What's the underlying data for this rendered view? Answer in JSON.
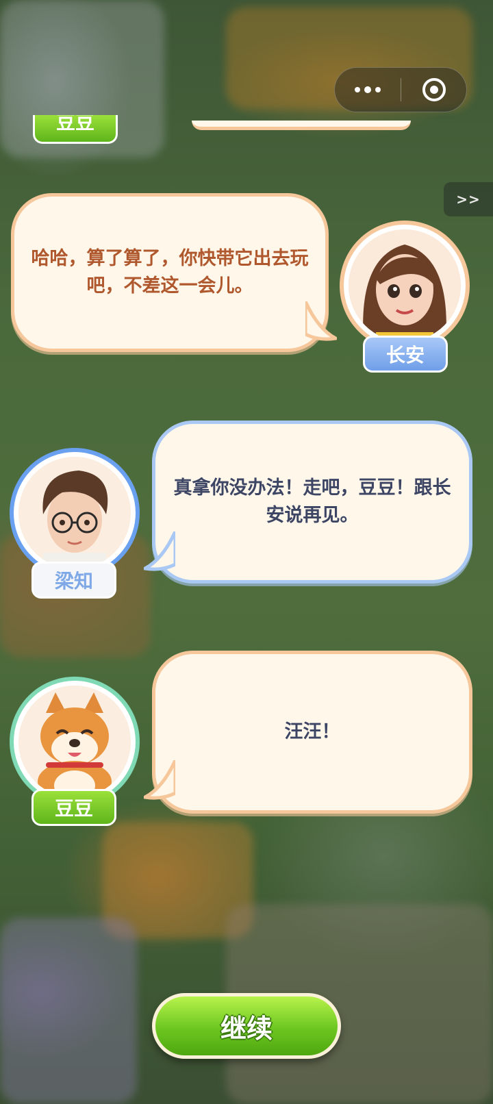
{
  "top_partial": {
    "nameplate_label": "豆豆"
  },
  "capsule": {
    "more_icon": "more-dots-icon",
    "close_icon": "target-circle-icon"
  },
  "skip": {
    "label": ">>"
  },
  "dialogues": [
    {
      "speaker": "长安",
      "text": "哈哈，算了算了，你快带它出去玩吧，不差这一会儿。",
      "theme": "#f6c79b"
    },
    {
      "speaker": "梁知",
      "text": "真拿你没办法！走吧，豆豆！跟长安说再见。",
      "theme": "#a9c8f3"
    },
    {
      "speaker": "豆豆",
      "text": "汪汪！",
      "theme": "#7fd9b4"
    }
  ],
  "continue_button": {
    "label": "继续"
  }
}
